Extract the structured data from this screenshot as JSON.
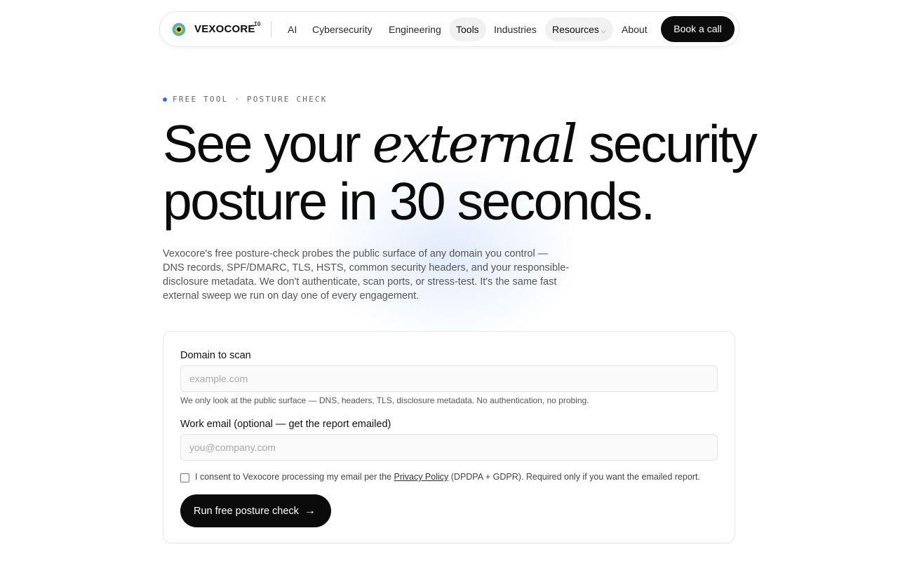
{
  "brand": {
    "name": "VEXOCORE",
    "suffix": ".IO"
  },
  "nav": {
    "items": [
      {
        "label": "AI"
      },
      {
        "label": "Cybersecurity"
      },
      {
        "label": "Engineering"
      },
      {
        "label": "Tools"
      },
      {
        "label": "Industries"
      },
      {
        "label": "Resources"
      },
      {
        "label": "About"
      }
    ],
    "active": "Tools",
    "cta": "Book a call"
  },
  "hero": {
    "eyebrow": "FREE TOOL · POSTURE CHECK",
    "headline_pre": "See your ",
    "headline_em": "external",
    "headline_post": " security posture in 30 seconds.",
    "lead": "Vexocore's free posture-check probes the public surface of any domain you control — DNS records, SPF/DMARC, TLS, HSTS, common security headers, and your responsible- disclosure metadata. We don't authenticate, scan ports, or stress-test. It's the same fast external sweep we run on day one of every engagement."
  },
  "form": {
    "domain_label": "Domain to scan",
    "domain_placeholder": "example.com",
    "domain_value": "",
    "domain_hint": "We only look at the public surface — DNS, headers, TLS, disclosure metadata. No authentication, no probing.",
    "email_label": "Work email (optional — get the report emailed)",
    "email_placeholder": "you@company.com",
    "email_value": "",
    "consent_pre": "I consent to Vexocore processing my email per the ",
    "consent_link": "Privacy Policy",
    "consent_post": " (DPDPA + GDPR). Required only if you want the emailed report.",
    "consent_checked": false,
    "submit_label": "Run free posture check",
    "submit_arrow": "→"
  },
  "colors": {
    "accent_dot": "#2f6fe0",
    "cta_bg": "#0b0b0b"
  },
  "icons": {
    "logo": "vexocore-logo-icon",
    "dropdown": "chevron-down-icon",
    "arrow": "arrow-right-icon"
  }
}
